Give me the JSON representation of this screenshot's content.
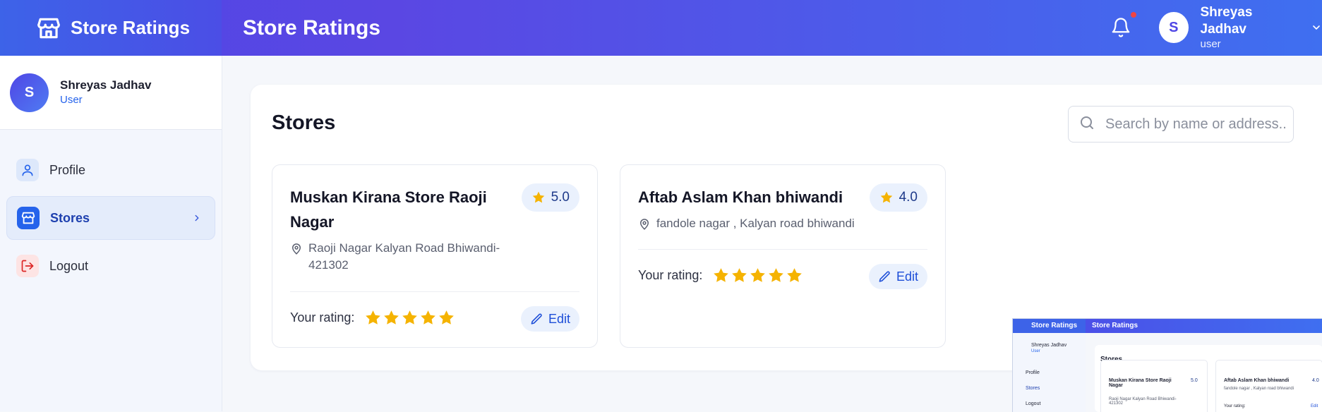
{
  "header": {
    "brand_title": "Store Ratings",
    "page_title": "Store Ratings",
    "user": {
      "initial": "S",
      "name": "Shreyas Jadhav",
      "role": "user"
    }
  },
  "sidebar": {
    "user": {
      "initial": "S",
      "name": "Shreyas Jadhav",
      "role": "User"
    },
    "items": [
      {
        "label": "Profile",
        "icon": "user-icon"
      },
      {
        "label": "Stores",
        "icon": "store-icon"
      },
      {
        "label": "Logout",
        "icon": "logout-icon"
      }
    ]
  },
  "main": {
    "title": "Stores",
    "search": {
      "placeholder": "Search by name or address..",
      "value": ""
    },
    "stores": [
      {
        "name": "Muskan Kirana Store Raoji Nagar",
        "rating": "5.0",
        "address": "Raoji Nagar Kalyan Road Bhiwandi-421302",
        "your_rating_label": "Your rating:",
        "your_rating": 5,
        "edit_label": "Edit"
      },
      {
        "name": "Aftab Aslam Khan bhiwandi",
        "rating": "4.0",
        "address": "fandole nagar , Kalyan road bhiwandi",
        "your_rating_label": "Your rating:",
        "your_rating": 5,
        "edit_label": "Edit"
      }
    ]
  },
  "thumbnail": {
    "brand_title": "Store Ratings",
    "page_title": "Store Ratings",
    "user_name": "Shreyas Jadhav",
    "user_role": "User",
    "nav": [
      "Profile",
      "Stores",
      "Logout"
    ],
    "title": "Stores",
    "store_1": "Muskan Kirana Store Raoji Nagar",
    "store_1_rating": "5.0",
    "store_1_address": "Raoji Nagar Kalyan Road Bhiwandi-421302",
    "store_2": "Aftab Aslam Khan bhiwandi",
    "store_2_rating": "4.0",
    "store_2_address": "fandole nagar , Kalyan road bhiwandi",
    "your_rating_label": "Your rating:",
    "edit_label": "Edit"
  },
  "colors": {
    "header_gradient_start": "#4f46e5",
    "header_gradient_end": "#3f6ff0",
    "accent": "#2563eb",
    "star": "#f5b301",
    "logout": "#dc2626"
  }
}
